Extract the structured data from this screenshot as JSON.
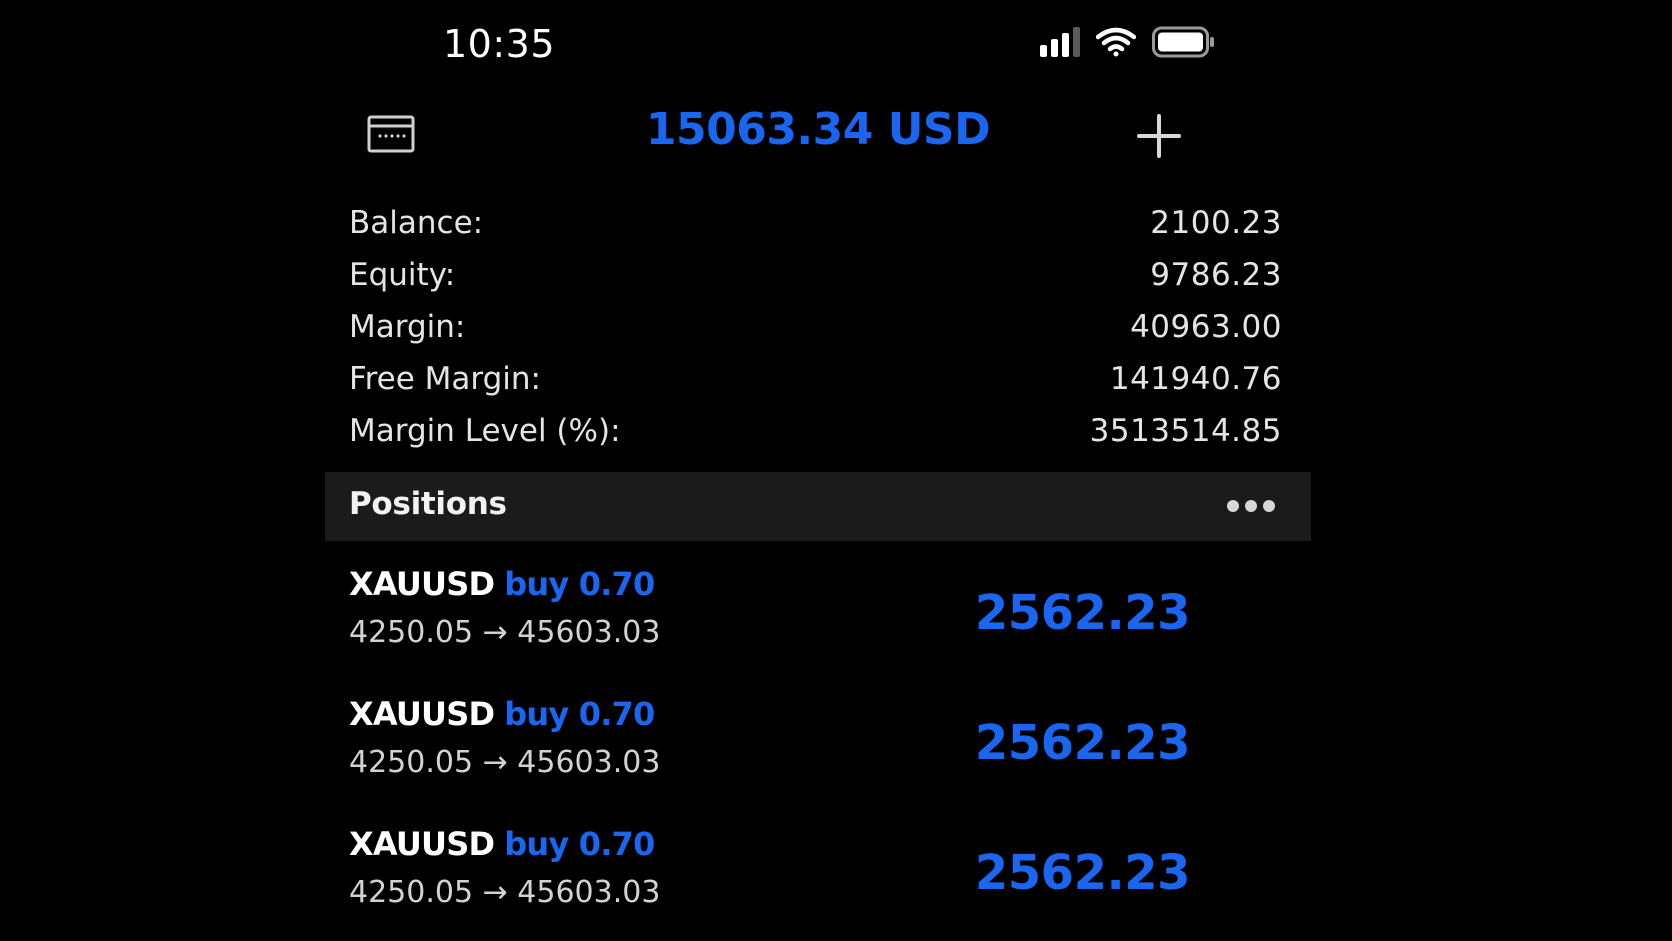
{
  "status_bar": {
    "time": "10:35"
  },
  "header": {
    "total_equity": "15063.34 USD",
    "wallet_icon": "wallet-icon",
    "add_icon": "plus-icon"
  },
  "account": {
    "rows": [
      {
        "label": "Balance:",
        "value": "2100.23"
      },
      {
        "label": "Equity:",
        "value": "9786.23"
      },
      {
        "label": "Margin:",
        "value": "40963.00"
      },
      {
        "label": "Free Margin:",
        "value": "141940.76"
      },
      {
        "label": "Margin Level (%):",
        "value": "3513514.85"
      }
    ]
  },
  "positions": {
    "title": "Positions",
    "items": [
      {
        "symbol": "XAUUSD",
        "side": "buy 0.70",
        "prices": "4250.05 → 45603.03",
        "profit": "2562.23"
      },
      {
        "symbol": "XAUUSD",
        "side": "buy 0.70",
        "prices": "4250.05 → 45603.03",
        "profit": "2562.23"
      },
      {
        "symbol": "XAUUSD",
        "side": "buy 0.70",
        "prices": "4250.05 → 45603.03",
        "profit": "2562.23"
      }
    ]
  },
  "colors": {
    "accent": "#1a66f0",
    "background": "#000000",
    "section_bg": "#1b1b1b"
  }
}
